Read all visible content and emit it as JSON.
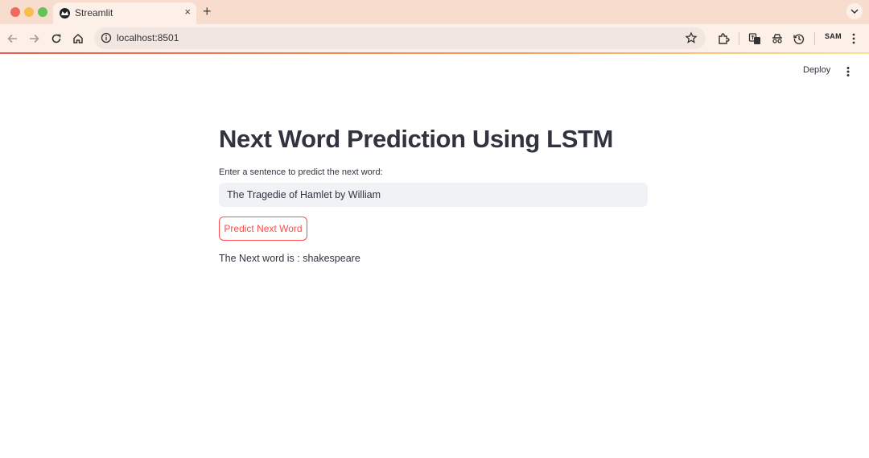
{
  "browser": {
    "tab_title": "Streamlit",
    "tab_close": "×",
    "new_tab": "+",
    "url": "localhost:8501",
    "profile": "SAM",
    "icons": [
      "back-icon",
      "forward-icon",
      "reload-icon",
      "home-icon",
      "info-icon",
      "star-icon",
      "extensions-icon",
      "translate-icon",
      "incognito-icon",
      "history-icon",
      "menu-icon"
    ]
  },
  "app_header": {
    "deploy_label": "Deploy"
  },
  "main": {
    "title": "Next Word Prediction Using LSTM",
    "input_label": "Enter a sentence to predict the next word:",
    "input_value": "The Tragedie of Hamlet by William",
    "button_label": "Predict Next Word",
    "result_text": "The Next word is : shakespeare"
  },
  "colors": {
    "accent": "#ff4b4b",
    "text": "#31333f",
    "input_bg": "#f0f2f6",
    "chrome_bg": "#f8dccd"
  }
}
